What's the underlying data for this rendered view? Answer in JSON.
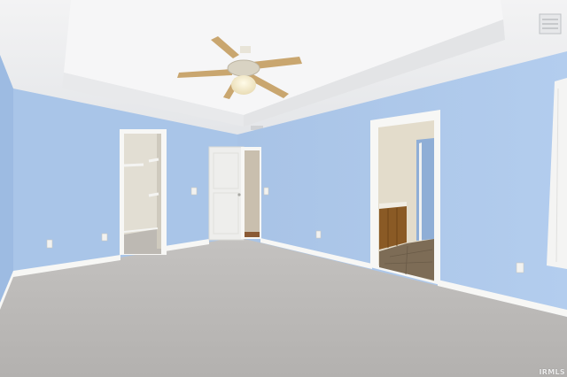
{
  "watermark": "IRMLS",
  "colors": {
    "wall": "#a9c4e6",
    "wall_shadow": "#9db9dd",
    "ceiling": "#eeeff1",
    "tray": "#f5f5f5",
    "carpet": "#bdbbb9",
    "trim": "#f7f7f5",
    "fan_blade": "#c9a66f",
    "door": "#f4f4f2",
    "cabinet": "#8a5a25",
    "tile": "#7a6a55"
  }
}
